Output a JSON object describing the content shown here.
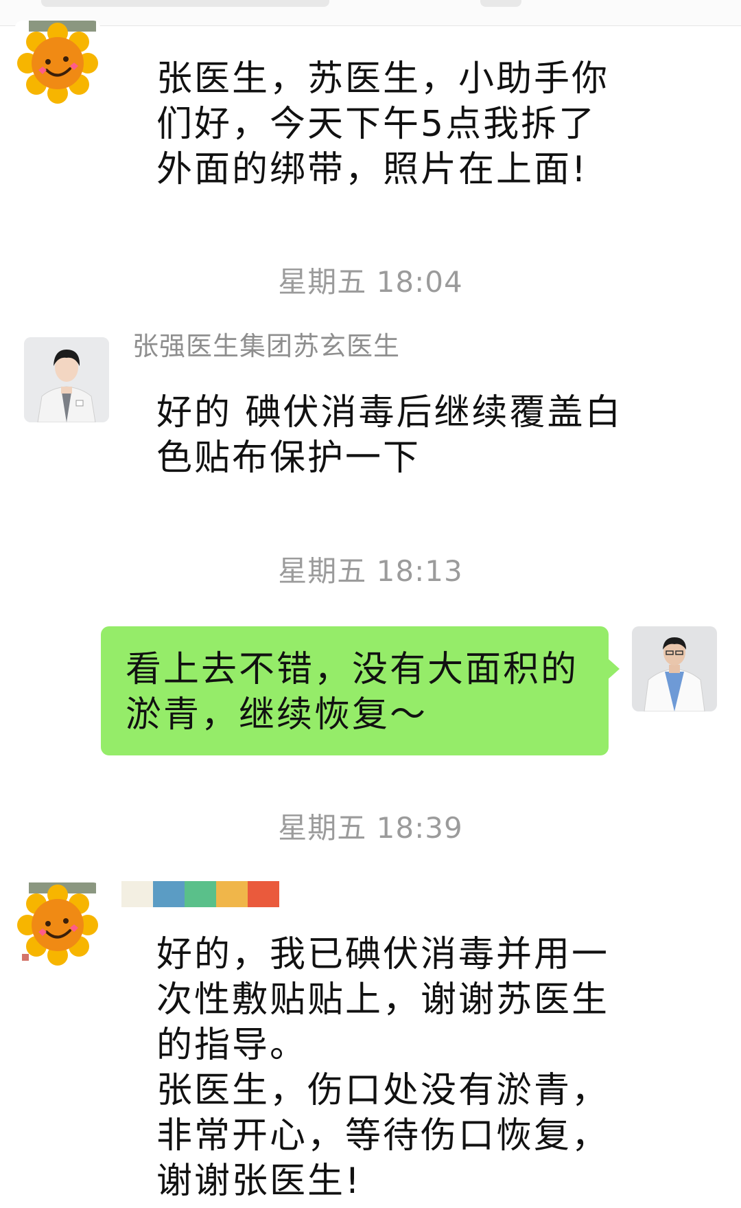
{
  "messages": [
    {
      "id": "m1",
      "direction": "incoming",
      "avatar": "sunflower-avatar",
      "text": "张医生，苏医生，小助手你\n们好，今天下午5点我拆了\n外面的绑带，照片在上面!"
    },
    {
      "id": "t1",
      "type": "timestamp",
      "text": "星期五 18:04"
    },
    {
      "id": "m2",
      "direction": "incoming",
      "avatar": "doctor-avatar",
      "sender": "张强医生集团苏玄医生",
      "text": "好的 碘伏消毒后继续覆盖白\n色贴布保护一下"
    },
    {
      "id": "t2",
      "type": "timestamp",
      "text": "星期五 18:13"
    },
    {
      "id": "m3",
      "direction": "outgoing",
      "avatar": "surgeon-avatar",
      "text": "看上去不错，没有大面积的\n淤青，继续恢复～"
    },
    {
      "id": "t3",
      "type": "timestamp",
      "text": "星期五 18:39"
    },
    {
      "id": "m4",
      "direction": "incoming",
      "avatar": "sunflower-avatar",
      "text": "好的，我已碘伏消毒并用一\n次性敷贴贴上，谢谢苏医生\n的指导。\n张医生，伤口处没有淤青，\n非常开心，等待伤口恢复，\n谢谢张医生!"
    }
  ],
  "colors": {
    "outgoing_bubble": "#95ec69",
    "timestamp_text": "#9b9b9b",
    "sender_name_text": "#8e8e8e",
    "message_text": "#111111"
  }
}
